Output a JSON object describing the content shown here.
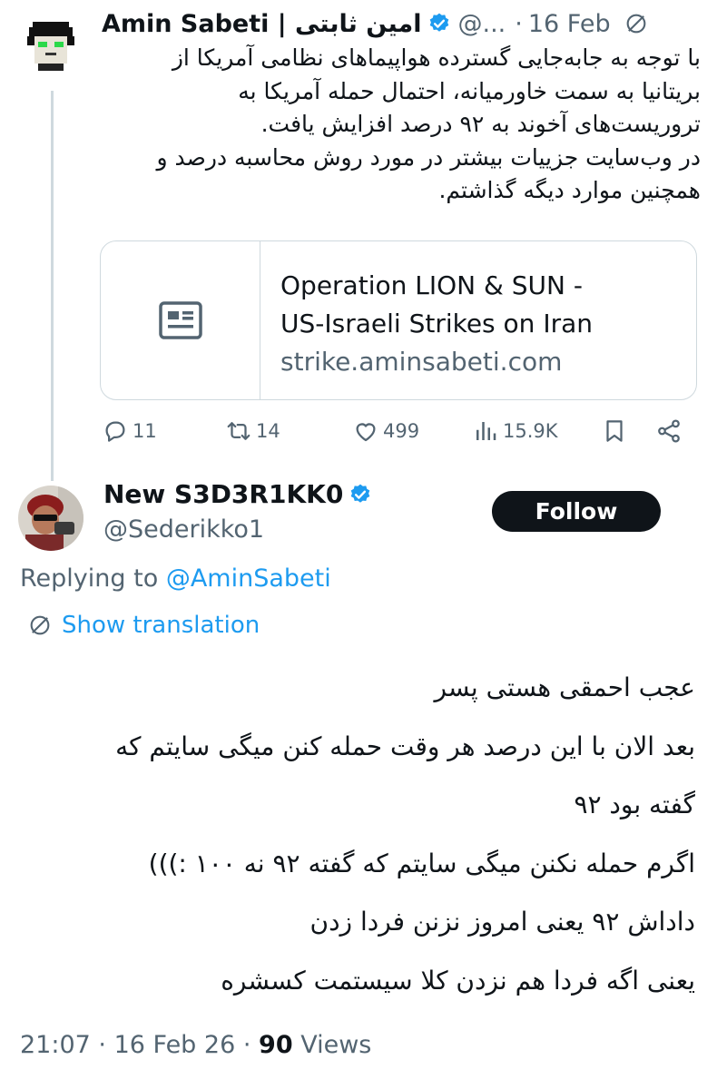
{
  "parent_tweet": {
    "author_name": "Amin Sabeti | امین ثابتی",
    "handle": "@...",
    "date": "16 Feb",
    "body_lines": [
      "با توجه به جابه‌جایی گسترده هواپیماهای نظامی آمریکا از",
      "بریتانیا به سمت خاورمیانه، احتمال حمله آمریکا به",
      "تروریست‌های آخوند به ۹۲ درصد افزایش یافت.",
      "در وب‌سایت جزییات بیشتر در مورد روش محاسبه درصد و",
      "همچنین موارد دیگه گذاشتم."
    ],
    "link_card": {
      "title_line1": "Operation LION & SUN -",
      "title_line2": "US-Israeli Strikes on Iran",
      "domain": "strike.aminsabeti.com"
    },
    "actions": {
      "replies": "11",
      "reposts": "14",
      "likes": "499",
      "views": "15.9K"
    }
  },
  "reply_tweet": {
    "author_name": "New S3D3R1KK0",
    "handle": "@Sederikko1",
    "follow_label": "Follow",
    "replying_prefix": "Replying to",
    "replying_mention": "@AminSabeti",
    "show_translation": "Show translation",
    "body_lines": [
      "عجب احمقی هستی پسر",
      "بعد الان با این درصد هر وقت حمله کنن میگی سایتم که",
      "گفته بود ۹۲",
      "اگرم حمله نکنن میگی سایتم که گفته ۹۲ نه ۱۰۰ :)))",
      "داداش ۹۲ یعنی امروز نزنن فردا زدن",
      "یعنی اگه فردا هم نزدن کلا سیستمت کسشره"
    ],
    "time": "21:07",
    "date": "16 Feb 26",
    "views_count": "90",
    "views_label": "Views"
  },
  "colors": {
    "text": "#0f1419",
    "secondary": "#536471",
    "accent": "#1d9bf0",
    "border": "#cfd9de"
  },
  "icons": [
    "verified-badge-icon",
    "globe-icon",
    "news-article-icon",
    "reply-icon",
    "repost-icon",
    "like-icon",
    "views-icon",
    "bookmark-icon",
    "share-icon",
    "translate-icon"
  ]
}
